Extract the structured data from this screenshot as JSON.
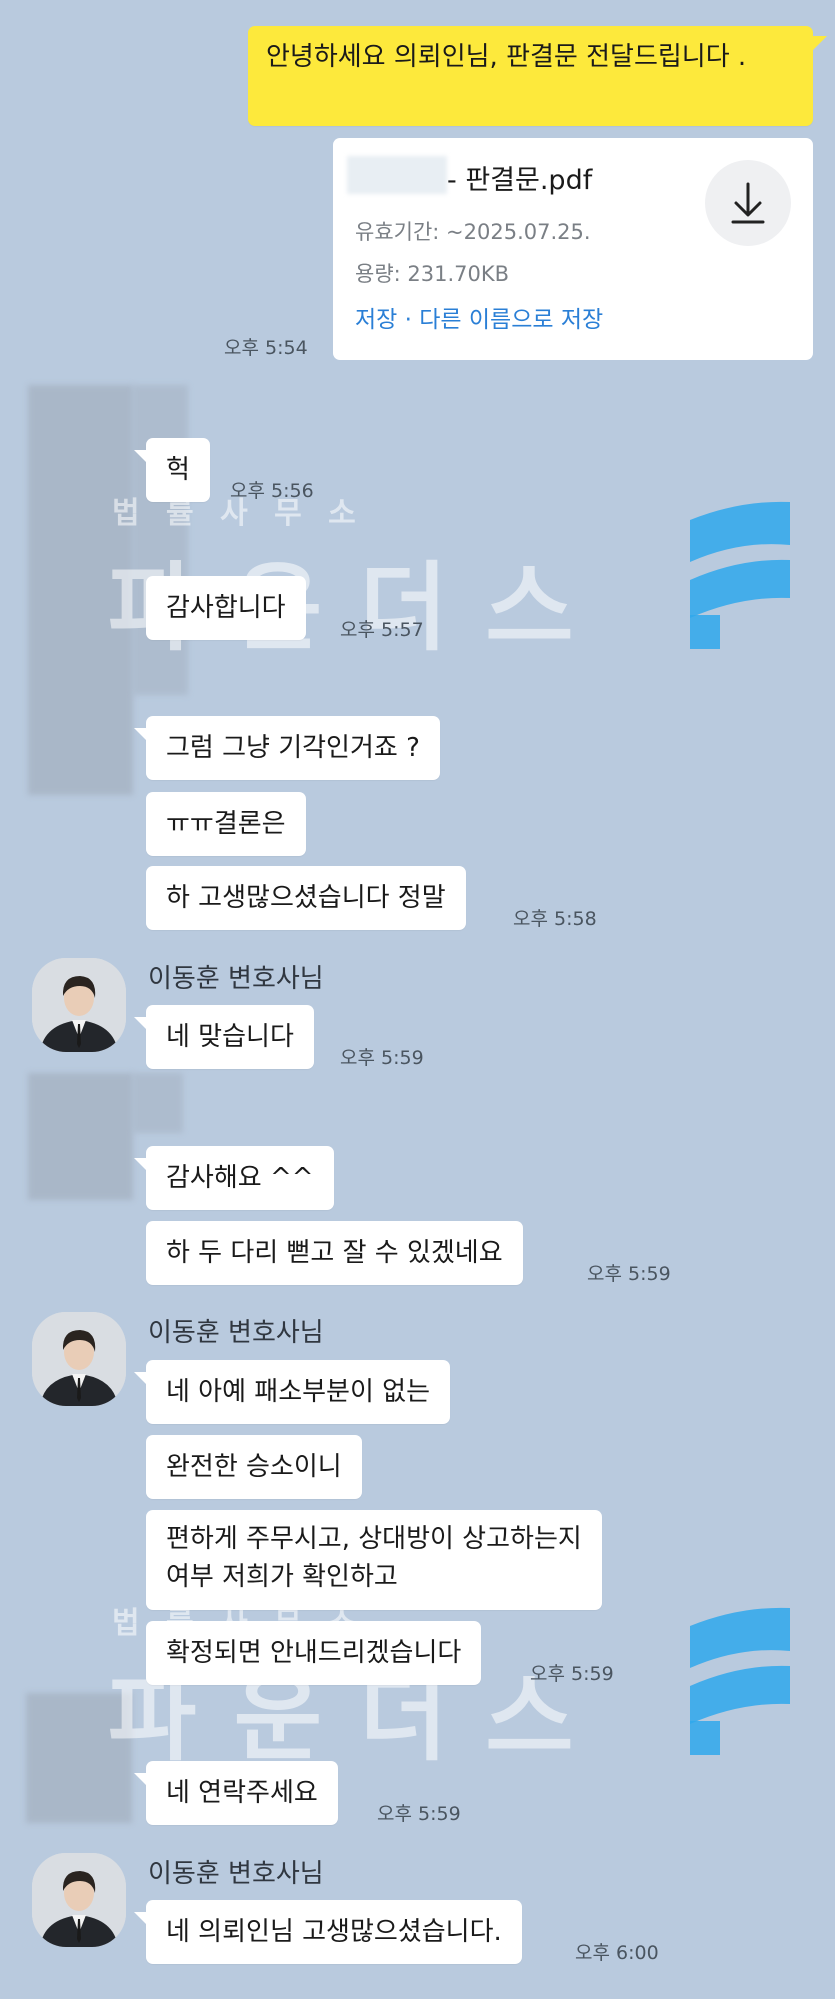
{
  "colors": {
    "background": "#b9cade",
    "my_bubble": "#fde93c",
    "their_bubble": "#ffffff",
    "link": "#2a7fd6",
    "watermark_blue": "#2fa8ec"
  },
  "watermark": {
    "small_text": "법 률 사 무 소",
    "big_text": "파 운 더 스"
  },
  "messages": {
    "m1": {
      "text": "안녕하세요 의뢰인님, 판결문 전달드립니다 ."
    },
    "file": {
      "name": "- 판결문.pdf",
      "expiry": "유효기간: ~2025.07.25.",
      "size": "용량: 231.70KB",
      "save": "저장",
      "separator": " · ",
      "save_as": "다른 이름으로 저장",
      "download_icon": "download-icon",
      "time": "오후 5:54"
    },
    "c1": {
      "text": "헉",
      "time": "오후 5:56"
    },
    "c2": {
      "text": "감사합니다",
      "time": "오후 5:57"
    },
    "c3": {
      "text": "그럼 그냥 기각인거죠 ?"
    },
    "c4": {
      "text": "ㅠㅠ결론은"
    },
    "c5": {
      "text": "하 고생많으셨습니다 정말",
      "time": "오후 5:58"
    },
    "lawyer_name": "이동훈 변호사님",
    "l1": {
      "text": "네 맞습니다",
      "time": "오후 5:59"
    },
    "c6": {
      "text": "감사해요 ^^"
    },
    "c7": {
      "text": "하 두 다리 뻗고 잘 수 있겠네요",
      "time": "오후 5:59"
    },
    "l2": {
      "text": "네 아예 패소부분이 없는"
    },
    "l3": {
      "text": "완전한 승소이니"
    },
    "l4": {
      "line1": "편하게 주무시고, 상대방이 상고하는지",
      "line2": "여부 저희가 확인하고"
    },
    "l5": {
      "text": "확정되면 안내드리겠습니다",
      "time": "오후 5:59"
    },
    "c8": {
      "text": "네 연락주세요",
      "time": "오후 5:59"
    },
    "l6": {
      "text": "네 의뢰인님 고생많으셨습니다.",
      "time": "오후 6:00"
    }
  }
}
